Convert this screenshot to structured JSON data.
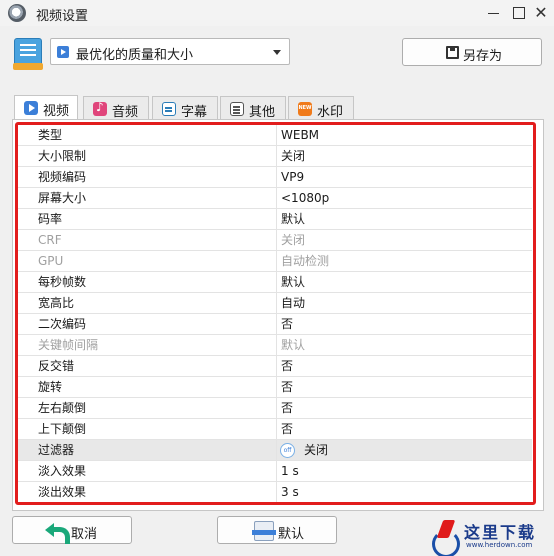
{
  "window": {
    "title": "视频设置"
  },
  "toolbar": {
    "preset_value": "最优化的质量和大小",
    "save_as_label": "另存为"
  },
  "tabs": [
    {
      "label": "视频",
      "icon": "video-icon"
    },
    {
      "label": "音频",
      "icon": "music-icon"
    },
    {
      "label": "字幕",
      "icon": "subtitle-icon"
    },
    {
      "label": "其他",
      "icon": "sliders-icon"
    },
    {
      "label": "水印",
      "icon": "new-badge-icon"
    }
  ],
  "settings": [
    {
      "key": "类型",
      "value": "WEBM",
      "enabled": true
    },
    {
      "key": "大小限制",
      "value": "关闭",
      "enabled": true
    },
    {
      "key": "视频编码",
      "value": "VP9",
      "enabled": true
    },
    {
      "key": "屏幕大小",
      "value": "<1080p",
      "enabled": true
    },
    {
      "key": "码率",
      "value": "默认",
      "enabled": true
    },
    {
      "key": "CRF",
      "value": "关闭",
      "enabled": false
    },
    {
      "key": "GPU",
      "value": "自动检测",
      "enabled": false
    },
    {
      "key": "每秒帧数",
      "value": "默认",
      "enabled": true
    },
    {
      "key": "宽高比",
      "value": "自动",
      "enabled": true
    },
    {
      "key": "二次编码",
      "value": "否",
      "enabled": true
    },
    {
      "key": "关键帧间隔",
      "value": "默认",
      "enabled": false
    },
    {
      "key": "反交错",
      "value": "否",
      "enabled": true
    },
    {
      "key": "旋转",
      "value": "否",
      "enabled": true
    },
    {
      "key": "左右颠倒",
      "value": "否",
      "enabled": true
    },
    {
      "key": "上下颠倒",
      "value": "否",
      "enabled": true
    },
    {
      "key": "过滤器",
      "value": "关闭",
      "toggle_text": "off",
      "enabled": true
    },
    {
      "key": "淡入效果",
      "value": "1 s",
      "enabled": true
    },
    {
      "key": "淡出效果",
      "value": "3 s",
      "enabled": true
    }
  ],
  "footer": {
    "cancel_label": "取消",
    "default_label": "默认"
  },
  "watermark": {
    "name": "这里下载",
    "url": "www.herdown.com"
  },
  "colors": {
    "highlight_frame": "#e21d1d",
    "accent": "#3c7fd8"
  }
}
